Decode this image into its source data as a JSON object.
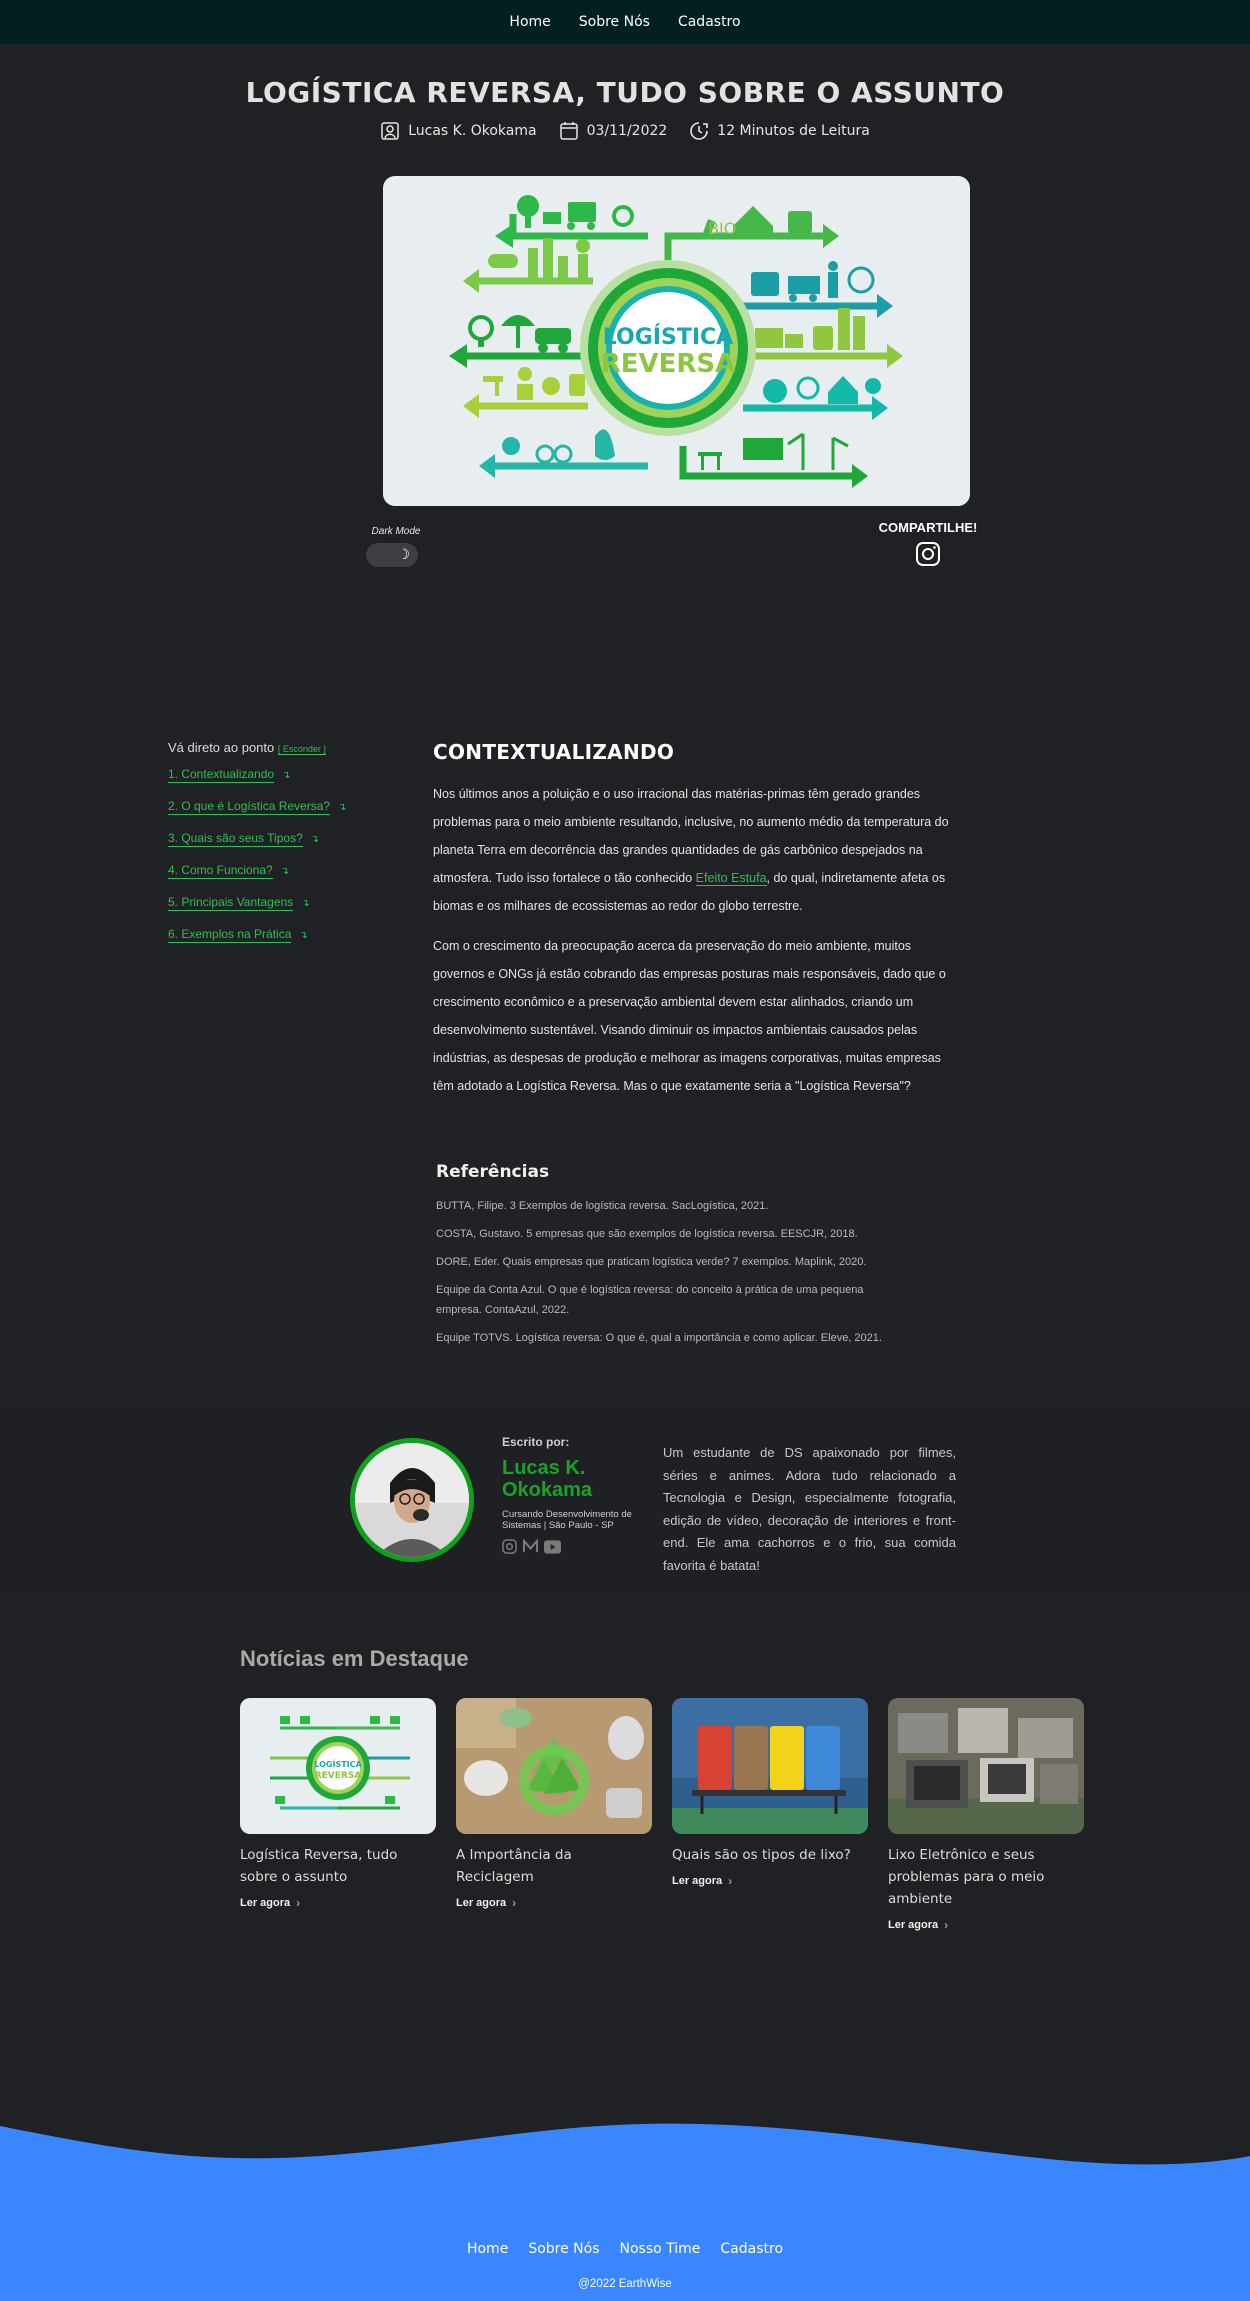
{
  "nav": {
    "links": [
      "Home",
      "Sobre Nós",
      "Cadastro"
    ]
  },
  "article": {
    "title": "LOGÍSTICA REVERSA, TUDO SOBRE O ASSUNTO",
    "author": "Lucas K. Okokama",
    "date": "03/11/2022",
    "read_time": "12 Minutos de Leitura",
    "hero_text_line1": "LOGÍSTICA",
    "hero_text_line2": "REVERSA",
    "hero_bio": "BIO"
  },
  "controls": {
    "dark_mode_label": "Dark Mode",
    "share_label": "COMPARTILHE!"
  },
  "toc": {
    "heading": "Vá direto ao ponto",
    "hide_label": "[ Esconder ]",
    "items": [
      "1. Contextualizando",
      "2. O que é Logística Reversa?",
      "3. Quais são seus Tipos?",
      "4. Como Funciona?",
      "5. Principais Vantagens",
      "6. Exemplos na Prática"
    ]
  },
  "section": {
    "heading": "CONTEXTUALIZANDO",
    "p1_before": "Nos últimos anos a poluição e o uso irracional das matérias-primas têm gerado grandes problemas para o meio ambiente resultando, inclusive, no aumento médio da temperatura do planeta Terra em decorrência das grandes quantidades de gás carbônico despejados na atmosfera. Tudo isso fortalece o tão conhecido ",
    "p1_link": "Efeito Estufa",
    "p1_after": ", do qual, indiretamente afeta os biomas e os milhares de ecossistemas ao redor do globo terrestre.",
    "p2": "Com o crescimento da preocupação acerca da preservação do meio ambiente, muitos governos e ONGs já estão cobrando das empresas posturas mais responsáveis, dado que o crescimento econômico e a preservação ambiental devem estar alinhados, criando um desenvolvimento sustentável. Visando diminuir os impactos ambientais causados pelas indústrias, as despesas de produção e melhorar as imagens corporativas, muitas empresas têm adotado a Logística Reversa. Mas o que exatamente seria a \"Logística Reversa\"?"
  },
  "references": {
    "heading": "Referências",
    "items": [
      "BUTTA, Filipe. 3 Exemplos de logística reversa. SacLogística, 2021.",
      "COSTA, Gustavo. 5 empresas que são exemplos de logística reversa. EESCJR, 2018.",
      "DORE, Eder. Quais empresas que praticam logística verde? 7 exemplos. Maplink, 2020.",
      "Equipe da Conta Azul. O que é logística reversa: do conceito à prática de uma pequena empresa. ContaAzul, 2022.",
      "Equipe TOTVS. Logística reversa: O que é, qual a importância e como aplicar. Eleve, 2021."
    ]
  },
  "author_box": {
    "written_by": "Escrito por:",
    "name": "Lucas K. Okokama",
    "role": "Cursando Desenvolvimento de Sistemas | São Paulo - SP",
    "bio": "Um estudante de DS apaixonado por filmes, séries e animes. Adora tudo relacionado a Tecnologia e Design, especialmente fotografia, edição de vídeo, decoração de interiores e front-end. Ele ama cachorros e o frio, sua comida favorita é batata!"
  },
  "news": {
    "heading": "Notícias em Destaque",
    "cards": [
      {
        "title": "Logística Reversa, tudo sobre o assunto",
        "cta": "Ler agora",
        "thumb_line1": "LOGÍSTICA",
        "thumb_line2": "REVERSA"
      },
      {
        "title": "A Importância da Reciclagem",
        "cta": "Ler agora"
      },
      {
        "title": "Quais são os tipos de lixo?",
        "cta": "Ler agora"
      },
      {
        "title": "Lixo Eletrônico e seus problemas para o meio ambiente",
        "cta": "Ler agora"
      }
    ]
  },
  "footer": {
    "links": [
      "Home",
      "Sobre Nós",
      "Nosso Time",
      "Cadastro"
    ],
    "copyright": "@2022 EarthWise",
    "color": "#3a86ff"
  },
  "colors": {
    "accent_green": "#2ebf57",
    "background": "#202124",
    "navbar": "#02201f"
  }
}
